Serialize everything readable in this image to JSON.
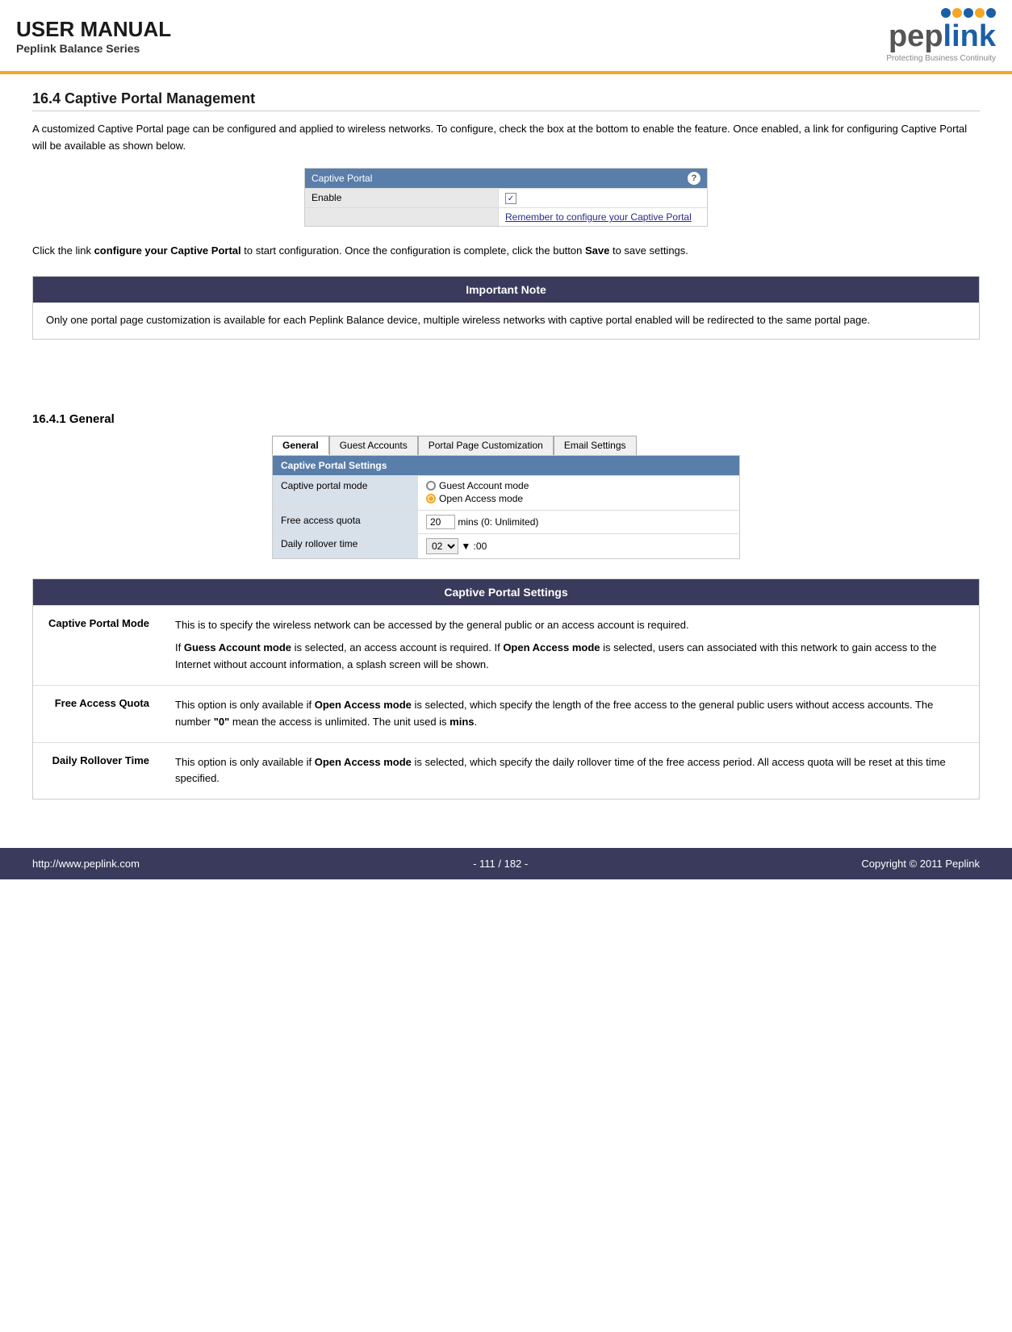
{
  "header": {
    "title": "USER MANUAL",
    "subtitle": "Peplink Balance Series",
    "logo_pep": "pep",
    "logo_link": "link",
    "logo_tagline": "Protecting Business Continuity"
  },
  "section_16_4": {
    "heading": "16.4  Captive Portal Management",
    "intro": "A customized Captive Portal page can be configured and applied to wireless networks. To configure, check the box at the bottom to enable the feature. Once enabled, a link for configuring Captive Portal will be available as shown below."
  },
  "captive_portal_mini": {
    "header_label": "Captive Portal",
    "enable_label": "Enable",
    "remember_label": "Remember to configure your Captive Portal"
  },
  "click_info": "Click the link configure your Captive Portal to start configuration. Once the configuration is complete, click the button Save to save settings.",
  "important_note": {
    "header": "Important Note",
    "body": "Only one portal page customization is available for each Peplink Balance device, multiple wireless networks with captive portal enabled will be redirected to the same portal page."
  },
  "section_16_4_1": {
    "heading": "16.4.1 General"
  },
  "tabs": [
    {
      "label": "General",
      "active": true
    },
    {
      "label": "Guest Accounts",
      "active": false
    },
    {
      "label": "Portal Page Customization",
      "active": false
    },
    {
      "label": "Email Settings",
      "active": false
    }
  ],
  "settings_mini": {
    "header": "Captive Portal Settings",
    "rows": [
      {
        "label": "Captive portal mode",
        "type": "radio",
        "options": [
          {
            "label": "Guest Account mode",
            "selected": false
          },
          {
            "label": "Open Access mode",
            "selected": true
          }
        ]
      },
      {
        "label": "Free access quota",
        "type": "input",
        "value": "20",
        "suffix": "mins (0: Unlimited)"
      },
      {
        "label": "Daily rollover time",
        "type": "select",
        "value": "02",
        "suffix": ":00"
      }
    ]
  },
  "captive_portal_settings_table": {
    "header": "Captive Portal Settings",
    "rows": [
      {
        "label": "Captive Portal Mode",
        "description_parts": [
          {
            "text": "This is to specify the wireless network can be accessed by the general public or an access account is required.",
            "bold": false
          },
          {
            "text": "If ",
            "bold": false
          },
          {
            "text": "Guess Account mode",
            "bold": true
          },
          {
            "text": " is selected, an access account is required. If ",
            "bold": false
          },
          {
            "text": "Open Access mode",
            "bold": true
          },
          {
            "text": " is selected, users can associated with this network to gain access to the Internet without account information, a splash screen will be shown.",
            "bold": false
          }
        ]
      },
      {
        "label": "Free Access Quota",
        "description_parts": [
          {
            "text": "This option is only available if ",
            "bold": false
          },
          {
            "text": "Open Access mode",
            "bold": true
          },
          {
            "text": " is selected, which specify the length of the free access to the general public users without access accounts. The number ",
            "bold": false
          },
          {
            "text": "\"0\"",
            "bold": true
          },
          {
            "text": " mean the access is unlimited. The unit used is ",
            "bold": false
          },
          {
            "text": "mins",
            "bold": true
          },
          {
            "text": ".",
            "bold": false
          }
        ]
      },
      {
        "label": "Daily Rollover Time",
        "description_parts": [
          {
            "text": "This option is only available if ",
            "bold": false
          },
          {
            "text": "Open Access mode",
            "bold": true
          },
          {
            "text": " is selected, which specify the daily rollover time of the free access period. All access quota will be reset at this  time specified.",
            "bold": false
          }
        ]
      }
    ]
  },
  "footer": {
    "url": "http://www.peplink.com",
    "page": "- 111 / 182 -",
    "copyright": "Copyright © 2011 Peplink"
  }
}
